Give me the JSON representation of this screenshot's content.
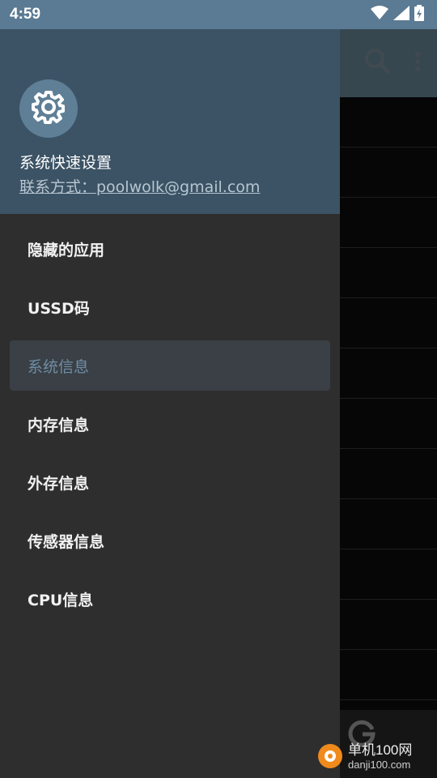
{
  "status_bar": {
    "time": "4:59"
  },
  "drawer": {
    "header": {
      "title": "系统快速设置",
      "contact": "联系方式：poolwolk@gmail.com"
    },
    "items": [
      {
        "label": "隐藏的应用",
        "active": false
      },
      {
        "label": "USSD码",
        "active": false
      },
      {
        "label": "系统信息",
        "active": true
      },
      {
        "label": "内存信息",
        "active": false
      },
      {
        "label": "外存信息",
        "active": false
      },
      {
        "label": "传感器信息",
        "active": false
      },
      {
        "label": "CPU信息",
        "active": false
      }
    ]
  },
  "watermark": {
    "line1": "单机100网",
    "line2": "danji100.com"
  },
  "colors": {
    "status_bar": "#5b7a93",
    "header": "#3b5365",
    "drawer": "#2e2e2e",
    "active_item_text": "#6f8da6"
  }
}
